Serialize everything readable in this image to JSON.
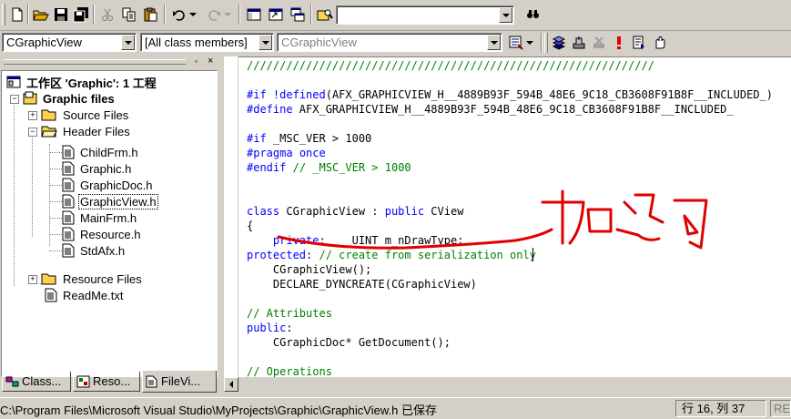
{
  "toolbar": {
    "find_combo_value": "",
    "buttons": [
      "new-file-icon",
      "open-icon",
      "save-icon",
      "save-all-icon",
      "cut-icon",
      "copy-icon",
      "paste-icon",
      "undo-icon",
      "redo-icon",
      "workspace-icon",
      "output-icon",
      "windows-icon",
      "find-in-files-icon",
      "find-icon"
    ]
  },
  "wizardbar": {
    "class_combo": "CGraphicView",
    "filter_combo": "[All class members]",
    "member_combo": "CGraphicView",
    "buttons": [
      "wizard-action-icon",
      "compile-icon",
      "build-icon",
      "stop-build-icon",
      "execute-icon",
      "go-icon",
      "breakpoint-icon"
    ]
  },
  "workspace": {
    "root": "工作区 'Graphic': 1 工程",
    "project": "Graphic files",
    "folders": {
      "source": "Source Files",
      "header": "Header Files",
      "resource": "Resource Files"
    },
    "header_files": [
      "ChildFrm.h",
      "Graphic.h",
      "GraphicDoc.h",
      "GraphicView.h",
      "MainFrm.h",
      "Resource.h",
      "StdAfx.h"
    ],
    "readme": "ReadMe.txt",
    "tabs": [
      "Class...",
      "Reso...",
      "FileVi..."
    ]
  },
  "editor": {
    "lines": [
      {
        "t": "c",
        "s": "//////////////////////////////////////////////////////////////"
      },
      {
        "t": "n",
        "s": ""
      },
      {
        "t": "k",
        "s": "#if !defined(AFX_GRAPHICVIEW_H__4889B93F_594B_48E6_9C18_CB3608F91B8F__INCLUDED_)"
      },
      {
        "t": "k",
        "s": "#define AFX_GRAPHICVIEW_H__4889B93F_594B_48E6_9C18_CB3608F91B8F__INCLUDED_"
      },
      {
        "t": "n",
        "s": ""
      },
      {
        "t": "k",
        "s": "#if _MSC_VER > 1000"
      },
      {
        "t": "k",
        "s": "#pragma once"
      },
      {
        "t": "k",
        "s": "#endif // _MSC_VER > 1000"
      },
      {
        "t": "n",
        "s": ""
      },
      {
        "t": "n",
        "s": ""
      },
      {
        "t": "k",
        "s": "class CGraphicView : public CView"
      },
      {
        "t": "n",
        "s": "{"
      },
      {
        "t": "k",
        "s": "    private:    UINT m_nDrawType;"
      },
      {
        "t": "k",
        "s": "protected: // create from serialization only"
      },
      {
        "t": "n",
        "s": "    CGraphicView();"
      },
      {
        "t": "n",
        "s": "    DECLARE_DYNCREATE(CGraphicView)"
      },
      {
        "t": "n",
        "s": ""
      },
      {
        "t": "c",
        "s": "// Attributes"
      },
      {
        "t": "k",
        "s": "public:"
      },
      {
        "t": "n",
        "s": "    CGraphicDoc* GetDocument();"
      },
      {
        "t": "n",
        "s": ""
      },
      {
        "t": "c",
        "s": "// Operations"
      }
    ],
    "annotation": "加这句",
    "annotation_color": "#e00000"
  },
  "status": {
    "message": "C:\\Program Files\\Microsoft Visual Studio\\MyProjects\\Graphic\\GraphicView.h 已保存",
    "position": "行 16, 列 37",
    "rec": "RE"
  }
}
